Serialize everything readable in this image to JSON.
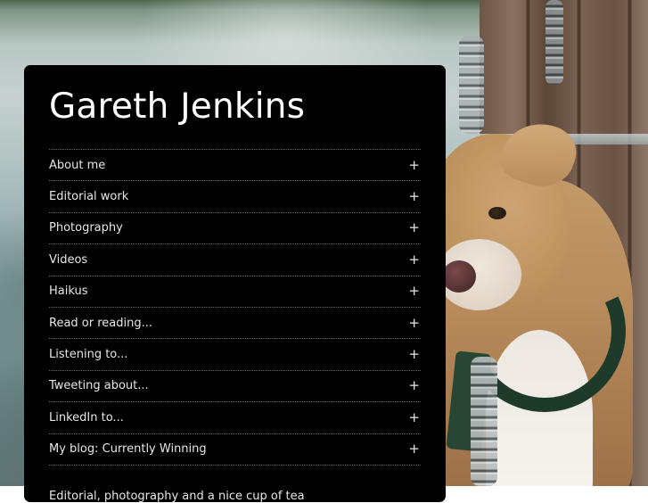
{
  "site": {
    "title": "Gareth Jenkins",
    "tagline": "Editorial, photography and a nice cup of tea"
  },
  "menu": {
    "toggle_symbol": "+",
    "items": [
      {
        "label": "About me"
      },
      {
        "label": "Editorial work"
      },
      {
        "label": "Photography"
      },
      {
        "label": "Videos"
      },
      {
        "label": "Haikus"
      },
      {
        "label": "Read or reading..."
      },
      {
        "label": "Listening to..."
      },
      {
        "label": "Tweeting about..."
      },
      {
        "label": "LinkedIn to..."
      },
      {
        "label": "My blog: Currently Winning"
      }
    ]
  },
  "colors": {
    "panel_background": "#000000",
    "text": "#e6e6e6",
    "title_text": "#ffffff",
    "divider": "#6b6b6b"
  }
}
